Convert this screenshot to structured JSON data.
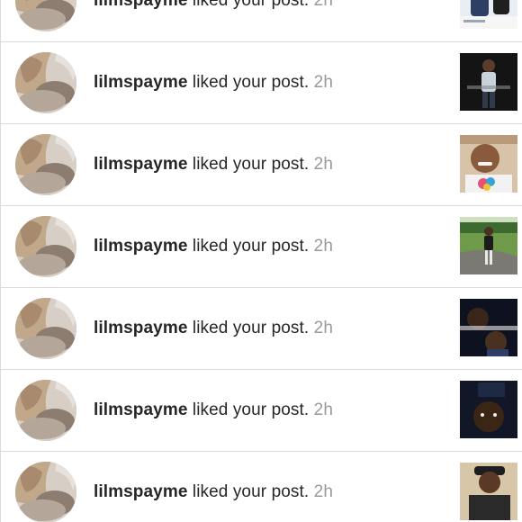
{
  "notifications": [
    {
      "username": "lilmspayme",
      "action": " liked your post.",
      "time": "2h",
      "thumbnail": "post-photo-1",
      "accent": "#4a6fa5"
    },
    {
      "username": "lilmspayme",
      "action": " liked your post.",
      "time": "2h",
      "thumbnail": "post-photo-2",
      "accent": "#2b2b2b"
    },
    {
      "username": "lilmspayme",
      "action": " liked your post.",
      "time": "2h",
      "thumbnail": "post-photo-3",
      "accent": "#e86a4a"
    },
    {
      "username": "lilmspayme",
      "action": " liked your post.",
      "time": "2h",
      "thumbnail": "post-photo-4",
      "accent": "#5b8a3a"
    },
    {
      "username": "lilmspayme",
      "action": " liked your post.",
      "time": "2h",
      "thumbnail": "post-photo-5",
      "accent": "#2c3e66"
    },
    {
      "username": "lilmspayme",
      "action": " liked your post.",
      "time": "2h",
      "thumbnail": "post-photo-6",
      "accent": "#1a2238"
    },
    {
      "username": "lilmspayme",
      "action": " liked your post.",
      "time": "2h",
      "thumbnail": "post-photo-7",
      "accent": "#8a6a4a"
    }
  ]
}
